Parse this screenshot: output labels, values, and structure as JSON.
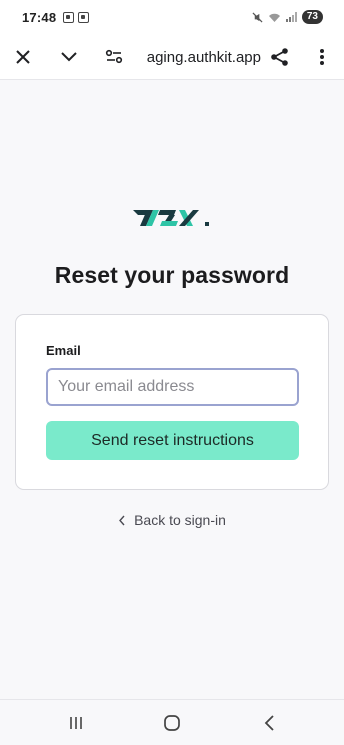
{
  "status_bar": {
    "time": "17:48",
    "battery": "73",
    "icons": [
      "screenshot-icon",
      "screenshot-icon",
      "mute-icon",
      "wifi-icon",
      "signal-icon"
    ]
  },
  "browser": {
    "url": "staging.authkit.app",
    "url_visible": "aging.authkit.app",
    "icons": [
      "close-icon",
      "chevron-down-icon",
      "site-settings-icon",
      "share-icon",
      "more-icon"
    ]
  },
  "page": {
    "logo_alt": "logo",
    "title": "Reset your password",
    "email_label": "Email",
    "email_placeholder": "Your email address",
    "email_value": "",
    "submit_label": "Send reset instructions",
    "back_label": "Back to sign-in"
  },
  "colors": {
    "accent": "#7aeacb",
    "logo_teal": "#2ec4a6",
    "logo_dark": "#1a3a40",
    "input_focus_border": "#9aa3d0"
  },
  "nav_bar": {
    "icons": [
      "recents-icon",
      "home-icon",
      "back-icon"
    ]
  }
}
